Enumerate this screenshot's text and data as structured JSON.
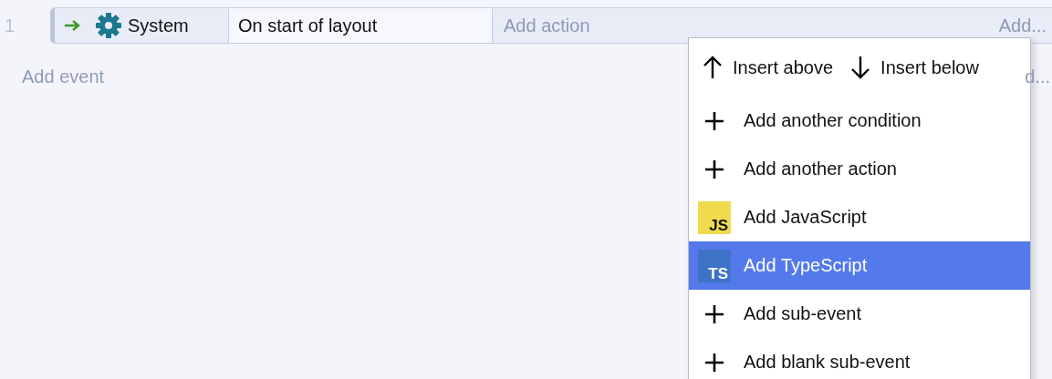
{
  "events": [
    {
      "number": "1",
      "object": "System",
      "condition": "On start of layout",
      "action_placeholder": "Add action",
      "add_more": "Add..."
    }
  ],
  "add_event": "Add event",
  "add_more_hidden": "d...",
  "context_menu": {
    "insert_row": [
      {
        "kind": "up",
        "label": "Insert above"
      },
      {
        "kind": "down",
        "label": "Insert below"
      }
    ],
    "items": [
      {
        "kind": "plus",
        "label": "Add another condition",
        "selected": false
      },
      {
        "kind": "plus",
        "label": "Add another action",
        "selected": false
      },
      {
        "kind": "js",
        "icon_text": "JS",
        "label": "Add JavaScript",
        "selected": false
      },
      {
        "kind": "ts",
        "icon_text": "TS",
        "label": "Add TypeScript",
        "selected": true
      },
      {
        "kind": "plus",
        "label": "Add sub-event",
        "selected": false
      },
      {
        "kind": "plus",
        "label": "Add blank sub-event",
        "selected": false
      }
    ]
  }
}
